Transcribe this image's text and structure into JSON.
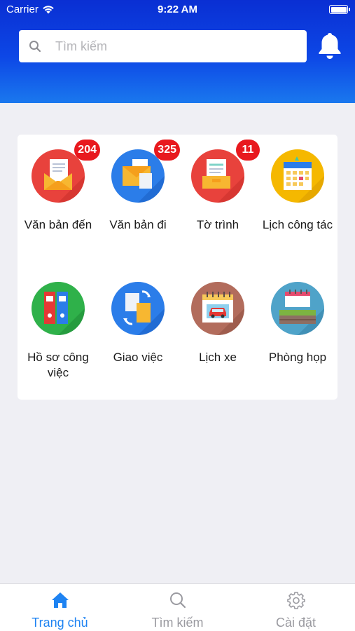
{
  "status_bar": {
    "carrier": "Carrier",
    "time": "9:22 AM"
  },
  "search": {
    "placeholder": "Tìm kiếm"
  },
  "header_icons": {
    "notifications": "bell-icon"
  },
  "modules": [
    {
      "label": "Văn bản đến",
      "badge": "204",
      "icon": "incoming-mail-icon",
      "color": "#e8423c"
    },
    {
      "label": "Văn bản đi",
      "badge": "325",
      "icon": "outgoing-mail-icon",
      "color": "#2b7de9"
    },
    {
      "label": "Tờ trình",
      "badge": "11",
      "icon": "proposal-document-icon",
      "color": "#e8423c"
    },
    {
      "label": "Lịch công tác",
      "badge": "",
      "icon": "calendar-icon",
      "color": "#f5b800"
    },
    {
      "label": "Hồ sơ công việc",
      "badge": "",
      "icon": "binders-icon",
      "color": "#2fb14a"
    },
    {
      "label": "Giao việc",
      "badge": "",
      "icon": "assign-task-icon",
      "color": "#2b7de9"
    },
    {
      "label": "Lịch xe",
      "badge": "",
      "icon": "car-schedule-icon",
      "color": "#b26c5c"
    },
    {
      "label": "Phòng họp",
      "badge": "",
      "icon": "meeting-room-icon",
      "color": "#4fa3c9"
    }
  ],
  "tab_bar": {
    "tabs": [
      {
        "label": "Trang chủ",
        "icon": "home-icon",
        "active": true
      },
      {
        "label": "Tìm kiếm",
        "icon": "search-icon",
        "active": false
      },
      {
        "label": "Cài đặt",
        "icon": "gear-icon",
        "active": false
      }
    ]
  },
  "colors": {
    "header_top": "#0a2fd3",
    "header_bottom": "#1a78ee",
    "accent": "#1e83f2",
    "badge": "#e8191e"
  }
}
